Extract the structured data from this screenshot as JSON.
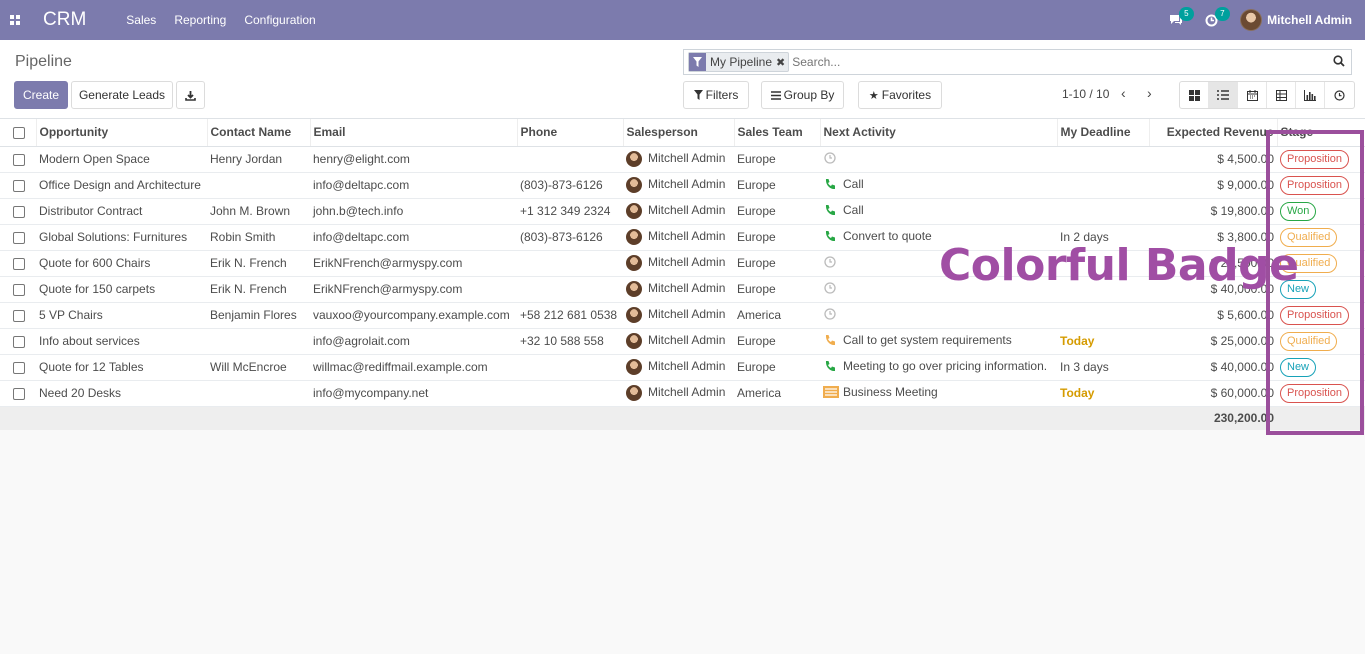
{
  "navbar": {
    "brand": "CRM",
    "menu": [
      "Sales",
      "Reporting",
      "Configuration"
    ],
    "messages_count": "5",
    "activities_count": "7",
    "user_name": "Mitchell Admin"
  },
  "control_panel": {
    "breadcrumb": "Pipeline",
    "create_label": "Create",
    "generate_leads_label": "Generate Leads",
    "search": {
      "facet": "My Pipeline",
      "placeholder": "Search..."
    },
    "filters_label": "Filters",
    "group_by_label": "Group By",
    "favorites_label": "Favorites",
    "pager": "1-10 / 10"
  },
  "table": {
    "columns": [
      "Opportunity",
      "Contact Name",
      "Email",
      "Phone",
      "Salesperson",
      "Sales Team",
      "Next Activity",
      "My Deadline",
      "Expected Revenue",
      "Stage"
    ],
    "rows": [
      {
        "opportunity": "Modern Open Space",
        "contact": "Henry Jordan",
        "email": "henry@elight.com",
        "phone": "",
        "salesperson": "Mitchell Admin",
        "team": "Europe",
        "activity": "",
        "activity_icon": "clock-icon",
        "deadline": "",
        "revenue": "$ 4,500.00",
        "stage": "Proposition"
      },
      {
        "opportunity": "Office Design and Architecture",
        "contact": "",
        "email": "info@deltapc.com",
        "phone": "(803)-873-6126",
        "salesperson": "Mitchell Admin",
        "team": "Europe",
        "activity": "Call",
        "activity_icon": "phone-icon",
        "deadline": "",
        "revenue": "$ 9,000.00",
        "stage": "Proposition"
      },
      {
        "opportunity": "Distributor Contract",
        "contact": "John M. Brown",
        "email": "john.b@tech.info",
        "phone": "+1 312 349 2324",
        "salesperson": "Mitchell Admin",
        "team": "Europe",
        "activity": "Call",
        "activity_icon": "phone-icon",
        "deadline": "",
        "revenue": "$ 19,800.00",
        "stage": "Won"
      },
      {
        "opportunity": "Global Solutions: Furnitures",
        "contact": "Robin Smith",
        "email": "info@deltapc.com",
        "phone": "(803)-873-6126",
        "salesperson": "Mitchell Admin",
        "team": "Europe",
        "activity": "Convert to quote",
        "activity_icon": "phone-icon",
        "deadline": "In 2 days",
        "revenue": "$ 3,800.00",
        "stage": "Qualified"
      },
      {
        "opportunity": "Quote for 600 Chairs",
        "contact": "Erik N. French",
        "email": "ErikNFrench@armyspy.com",
        "phone": "",
        "salesperson": "Mitchell Admin",
        "team": "Europe",
        "activity": "",
        "activity_icon": "clock-icon",
        "deadline": "",
        "revenue": "$ 22,500.00",
        "stage": "Qualified"
      },
      {
        "opportunity": "Quote for 150 carpets",
        "contact": "Erik N. French",
        "email": "ErikNFrench@armyspy.com",
        "phone": "",
        "salesperson": "Mitchell Admin",
        "team": "Europe",
        "activity": "",
        "activity_icon": "clock-icon",
        "deadline": "",
        "revenue": "$ 40,000.00",
        "stage": "New"
      },
      {
        "opportunity": "5 VP Chairs",
        "contact": "Benjamin Flores",
        "email": "vauxoo@yourcompany.example.com",
        "phone": "+58 212 681 0538",
        "salesperson": "Mitchell Admin",
        "team": "America",
        "activity": "",
        "activity_icon": "clock-icon",
        "deadline": "",
        "revenue": "$ 5,600.00",
        "stage": "Proposition"
      },
      {
        "opportunity": "Info about services",
        "contact": "",
        "email": "info@agrolait.com",
        "phone": "+32 10 588 558",
        "salesperson": "Mitchell Admin",
        "team": "Europe",
        "activity": "Call to get system requirements",
        "activity_icon": "phone-icon-orange",
        "deadline": "Today",
        "revenue": "$ 25,000.00",
        "stage": "Qualified"
      },
      {
        "opportunity": "Quote for 12 Tables",
        "contact": "Will McEncroe",
        "email": "willmac@rediffmail.example.com",
        "phone": "",
        "salesperson": "Mitchell Admin",
        "team": "Europe",
        "activity": "Meeting to go over pricing information.",
        "activity_icon": "phone-icon",
        "deadline": "In 3 days",
        "revenue": "$ 40,000.00",
        "stage": "New"
      },
      {
        "opportunity": "Need 20 Desks",
        "contact": "",
        "email": "info@mycompany.net",
        "phone": "",
        "salesperson": "Mitchell Admin",
        "team": "America",
        "activity": "Business Meeting",
        "activity_icon": "meeting-icon",
        "deadline": "Today",
        "revenue": "$ 60,000.00",
        "stage": "Proposition"
      }
    ],
    "total_revenue": "230,200.00"
  },
  "annotation": {
    "text": "Colorful Badge",
    "color": "#a04ea4"
  },
  "colors": {
    "brand": "#7c7bad",
    "proposition": "#d9534f",
    "won": "#28a745",
    "qualified": "#f0ad4e",
    "new": "#17a2b8"
  }
}
